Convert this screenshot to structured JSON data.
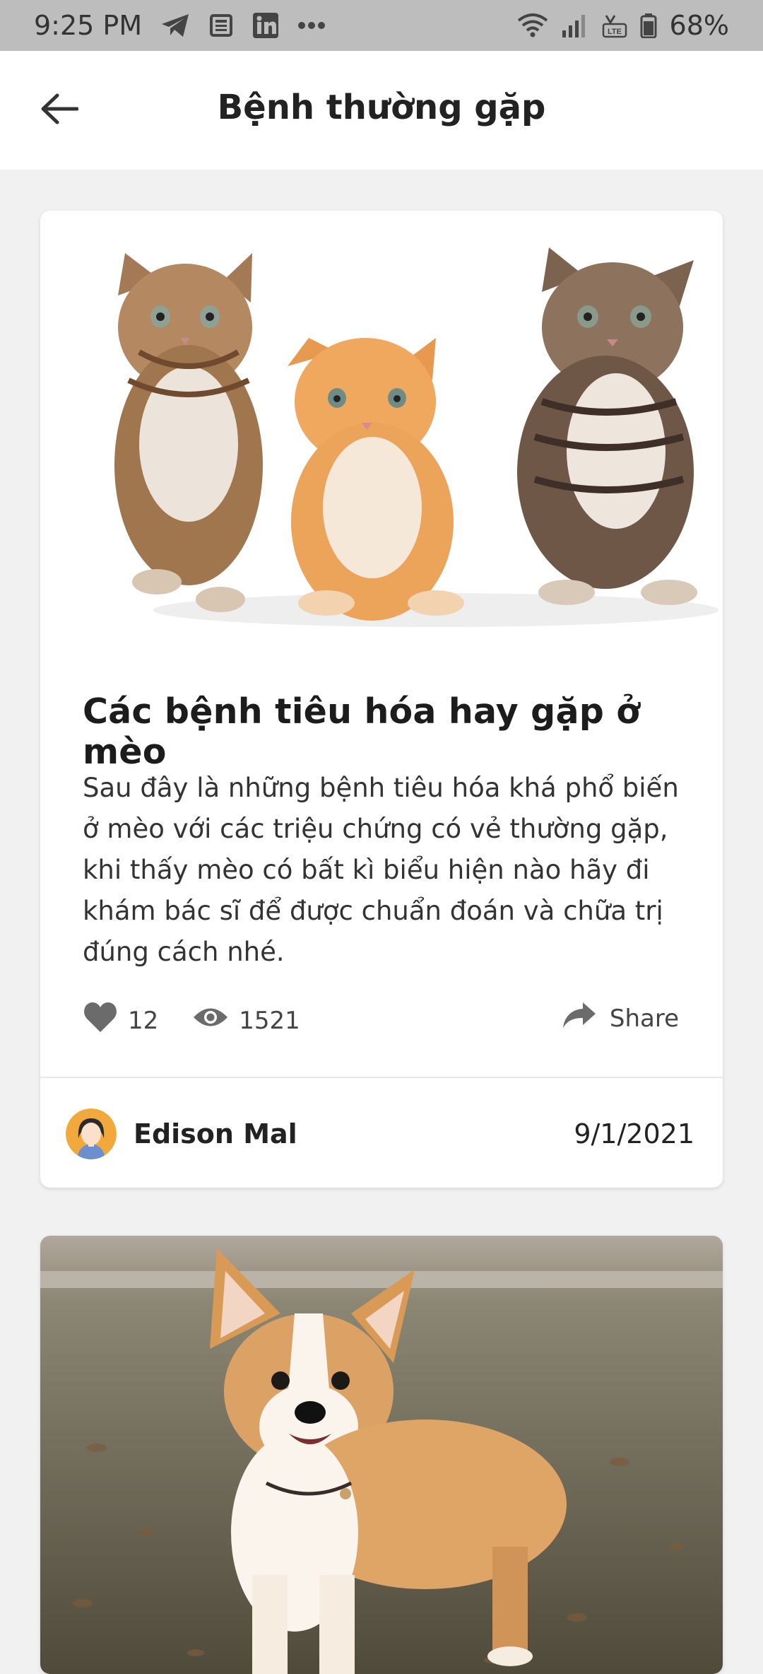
{
  "status_bar": {
    "time": "9:25 PM",
    "battery_percent": "68%",
    "network_label": "LTE"
  },
  "header": {
    "title": "Bệnh thường gặp"
  },
  "articles": [
    {
      "title": "Các bệnh tiêu hóa hay gặp ở mèo",
      "description": "Sau đây là những bệnh tiêu hóa khá phổ biến ở mèo với các triệu chứng có vẻ thường gặp, khi thấy mèo có bất kì biểu hiện nào hãy đi khám bác sĩ để được chuẩn đoán và chữa trị đúng cách nhé.",
      "likes": "12",
      "views": "1521",
      "share_label": "Share",
      "author": "Edison Mal",
      "date": "9/1/2021"
    }
  ],
  "colors": {
    "status_bar_bg": "#bdbdbd",
    "page_bg": "#f1f1f1",
    "card_bg": "#ffffff",
    "icon_gray": "#6b6b6b",
    "avatar_bg": "#f2a93b"
  },
  "icons": {
    "back": "arrow-left-icon",
    "like": "heart-icon",
    "views": "eye-icon",
    "share": "share-arrow-icon"
  }
}
